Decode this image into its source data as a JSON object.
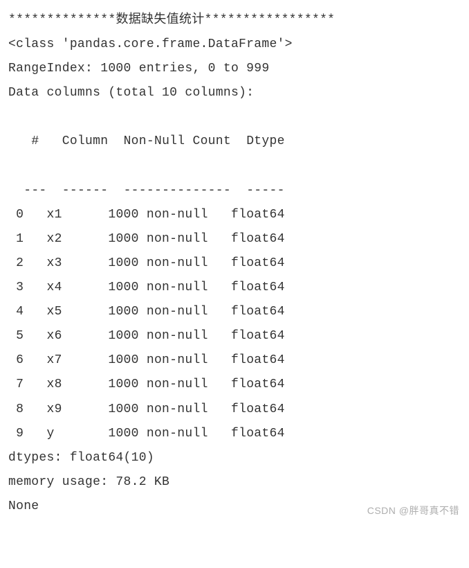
{
  "header": {
    "stars_left": "**************",
    "title_cjk": "数据缺失值统计",
    "stars_right": "*****************"
  },
  "class_line": "<class 'pandas.core.frame.DataFrame'>",
  "range_index": "RangeIndex: 1000 entries, 0 to 999",
  "data_columns_line": "Data columns (total 10 columns):",
  "column_header": {
    "idx": " #   ",
    "column": "Column  ",
    "nonnull": "Non-Null Count  ",
    "dtype": "Dtype  "
  },
  "column_dashes": {
    "idx": "---  ",
    "column": "------  ",
    "nonnull": "--------------  ",
    "dtype": "-----  "
  },
  "rows": [
    {
      "idx": " 0   ",
      "name": "x1      ",
      "count": "1000 non-null   ",
      "dtype": "float64"
    },
    {
      "idx": " 1   ",
      "name": "x2      ",
      "count": "1000 non-null   ",
      "dtype": "float64"
    },
    {
      "idx": " 2   ",
      "name": "x3      ",
      "count": "1000 non-null   ",
      "dtype": "float64"
    },
    {
      "idx": " 3   ",
      "name": "x4      ",
      "count": "1000 non-null   ",
      "dtype": "float64"
    },
    {
      "idx": " 4   ",
      "name": "x5      ",
      "count": "1000 non-null   ",
      "dtype": "float64"
    },
    {
      "idx": " 5   ",
      "name": "x6      ",
      "count": "1000 non-null   ",
      "dtype": "float64"
    },
    {
      "idx": " 6   ",
      "name": "x7      ",
      "count": "1000 non-null   ",
      "dtype": "float64"
    },
    {
      "idx": " 7   ",
      "name": "x8      ",
      "count": "1000 non-null   ",
      "dtype": "float64"
    },
    {
      "idx": " 8   ",
      "name": "x9      ",
      "count": "1000 non-null   ",
      "dtype": "float64"
    },
    {
      "idx": " 9   ",
      "name": "y       ",
      "count": "1000 non-null   ",
      "dtype": "float64"
    }
  ],
  "dtypes_line": "dtypes: float64(10)",
  "memory_line": "memory usage: 78.2 KB",
  "none_line": "None",
  "watermark": "CSDN @胖哥真不错"
}
